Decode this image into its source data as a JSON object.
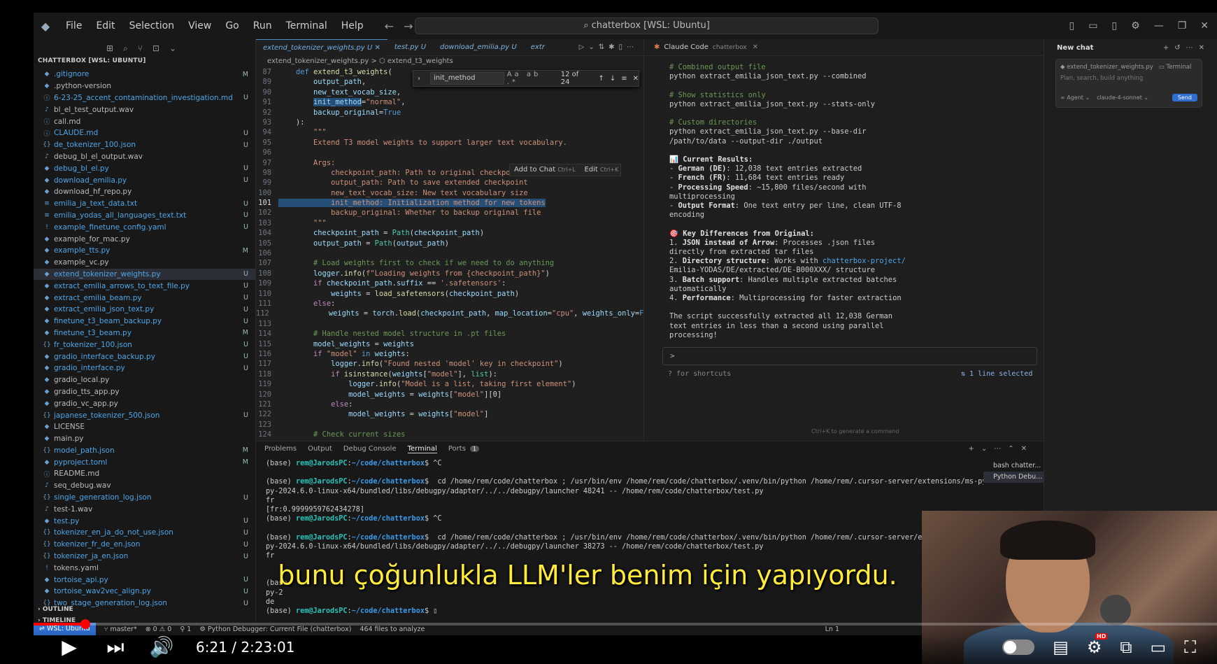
{
  "titlebar": {
    "menu": [
      "File",
      "Edit",
      "Selection",
      "View",
      "Go",
      "Run",
      "Terminal",
      "Help"
    ],
    "search": "chatterbox [WSL: Ubuntu]"
  },
  "explorer": {
    "title": "CHATTERBOX [WSL: UBUNTU]",
    "files": [
      {
        "name": ".gitignore",
        "status": "M"
      },
      {
        "name": ".python-version",
        "status": ""
      },
      {
        "name": "6-23-25_accent_contamination_investigation.md",
        "status": "U"
      },
      {
        "name": "bl_el_test_output.wav",
        "status": ""
      },
      {
        "name": "call.md",
        "status": ""
      },
      {
        "name": "CLAUDE.md",
        "status": "U"
      },
      {
        "name": "de_tokenizer_100.json",
        "status": "U"
      },
      {
        "name": "debug_bl_el_output.wav",
        "status": ""
      },
      {
        "name": "debug_bl_el.py",
        "status": "U"
      },
      {
        "name": "download_emilia.py",
        "status": "U"
      },
      {
        "name": "download_hf_repo.py",
        "status": ""
      },
      {
        "name": "emilia_ja_text_data.txt",
        "status": "U"
      },
      {
        "name": "emilia_yodas_all_languages_text.txt",
        "status": "U"
      },
      {
        "name": "example_finetune_config.yaml",
        "status": "U"
      },
      {
        "name": "example_for_mac.py",
        "status": ""
      },
      {
        "name": "example_tts.py",
        "status": "M"
      },
      {
        "name": "example_vc.py",
        "status": ""
      },
      {
        "name": "extend_tokenizer_weights.py",
        "status": "U"
      },
      {
        "name": "extract_emilia_arrows_to_text_file.py",
        "status": "U"
      },
      {
        "name": "extract_emilia_beam.py",
        "status": "U"
      },
      {
        "name": "extract_emilia_json_text.py",
        "status": "U"
      },
      {
        "name": "finetune_t3_beam_backup.py",
        "status": "U"
      },
      {
        "name": "finetune_t3_beam.py",
        "status": "M"
      },
      {
        "name": "fr_tokenizer_100.json",
        "status": "U"
      },
      {
        "name": "gradio_interface_backup.py",
        "status": "U"
      },
      {
        "name": "gradio_interface.py",
        "status": "U"
      },
      {
        "name": "gradio_local.py",
        "status": ""
      },
      {
        "name": "gradio_tts_app.py",
        "status": ""
      },
      {
        "name": "gradio_vc_app.py",
        "status": ""
      },
      {
        "name": "japanese_tokenizer_500.json",
        "status": "U"
      },
      {
        "name": "LICENSE",
        "status": ""
      },
      {
        "name": "main.py",
        "status": ""
      },
      {
        "name": "model_path.json",
        "status": "M"
      },
      {
        "name": "pyproject.toml",
        "status": "M"
      },
      {
        "name": "README.md",
        "status": ""
      },
      {
        "name": "seq_debug.wav",
        "status": ""
      },
      {
        "name": "single_generation_log.json",
        "status": "U"
      },
      {
        "name": "test-1.wav",
        "status": ""
      },
      {
        "name": "test.py",
        "status": "U"
      },
      {
        "name": "tokenizer_en_ja_do_not_use.json",
        "status": "U"
      },
      {
        "name": "tokenizer_fr_de_en.json",
        "status": "U"
      },
      {
        "name": "tokenizer_ja_en.json",
        "status": "U"
      },
      {
        "name": "tokens.yaml",
        "status": ""
      },
      {
        "name": "tortoise_api.py",
        "status": "U"
      },
      {
        "name": "tortoise_wav2vec_align.py",
        "status": "U"
      },
      {
        "name": "two_stage_generation_log.json",
        "status": "U"
      }
    ],
    "outline": "OUTLINE",
    "timeline": "TIMELINE"
  },
  "editor": {
    "tabs": [
      "extend_tokenizer_weights.py U",
      "test.py U",
      "download_emilia.py U",
      "extr"
    ],
    "breadcrumb": "extend_tokenizer_weights.py > ⬡ extend_t3_weights",
    "find": {
      "query": "init_method",
      "count": "12 of 24"
    },
    "popup": {
      "chat": "Add to Chat",
      "chat_key": "Ctrl+L",
      "edit": "Edit",
      "edit_key": "Ctrl+K"
    }
  },
  "claude": {
    "title": "Claude Code",
    "subtitle": "chatterbox",
    "input_prompt": ">",
    "hint": "? for shortcuts",
    "selection": "⇅ 1 line selected",
    "gen_hint": "Ctrl+K to generate a command"
  },
  "chat": {
    "title": "New chat",
    "context_file": "extend_tokenizer_weights.py",
    "context_term": "Terminal",
    "placeholder": "Plan, search, build anything",
    "agent": "Agent",
    "model": "claude-4-sonnet",
    "send": "Send"
  },
  "panel": {
    "tabs": [
      "Problems",
      "Output",
      "Debug Console",
      "Terminal",
      "Ports"
    ],
    "ports_badge": "1",
    "terminals": [
      "bash chatter...",
      "Python Debu..."
    ]
  },
  "status": {
    "remote": "WSL: Ubuntu",
    "branch": "master*",
    "problems": "⊗ 0 ⚠ 0",
    "ports": "⚲ 1",
    "debugger": "Python Debugger: Current File (chatterbox)",
    "files": "464 files to analyze",
    "ln": "Ln 1"
  },
  "video": {
    "subtitle": "bunu çoğunlukla LLM'ler benim için yapıyordu.",
    "time": "6:21 / 2:23:01",
    "progress": 0.044,
    "hd": "HD"
  }
}
